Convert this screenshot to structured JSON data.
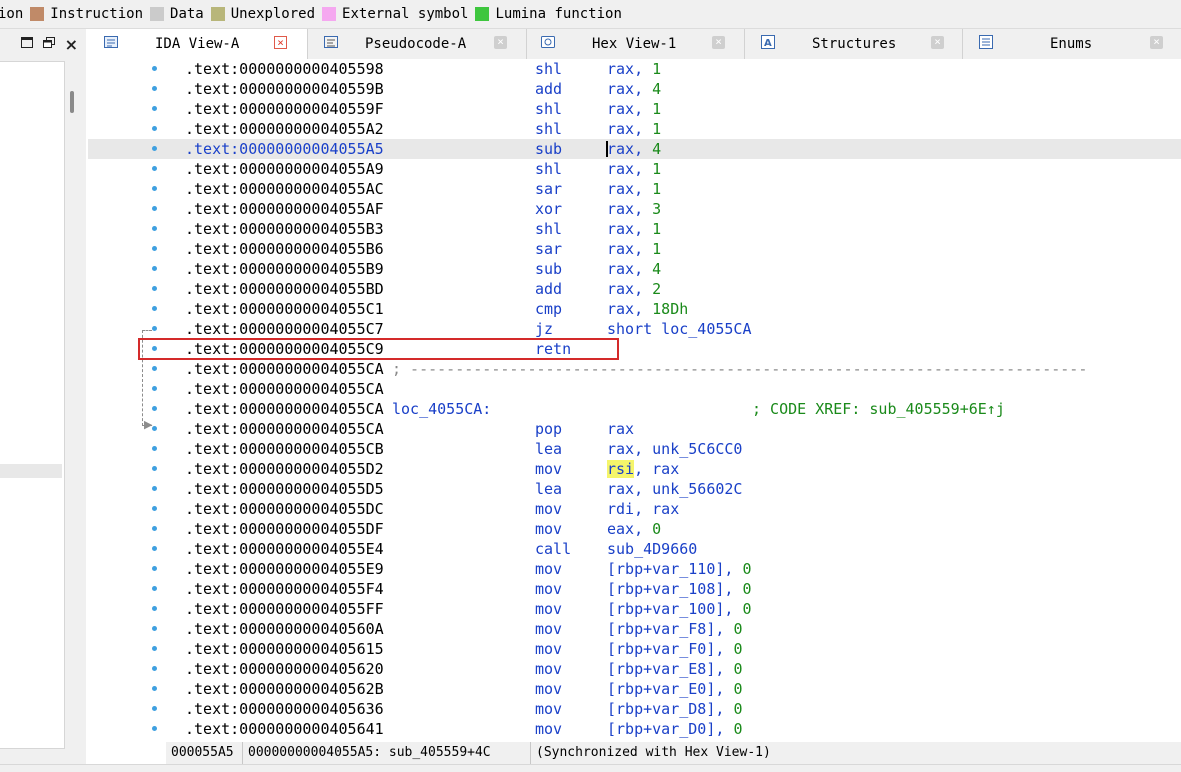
{
  "legend": [
    {
      "label": "ion",
      "color": ""
    },
    {
      "label": "Instruction",
      "color": "#c08a68"
    },
    {
      "label": "Data",
      "color": "#cbcbcb"
    },
    {
      "label": "Unexplored",
      "color": "#b8b67a"
    },
    {
      "label": "External symbol",
      "color": "#f5a8f0"
    },
    {
      "label": "Lumina function",
      "color": "#3ec63e"
    }
  ],
  "left_toolbar": {
    "restore_icon": "maximize-icon",
    "float_icon": "float-icon",
    "close": "×"
  },
  "tabs": [
    {
      "label": "IDA View-A",
      "icon": "ida-view-icon",
      "active": true
    },
    {
      "label": "Pseudocode-A",
      "icon": "pseudocode-icon",
      "active": false
    },
    {
      "label": "Hex View-1",
      "icon": "hex-view-icon",
      "active": false
    },
    {
      "label": "Structures",
      "icon": "structures-icon",
      "active": false
    },
    {
      "label": "Enums",
      "icon": "enums-icon",
      "active": false
    }
  ],
  "tab_close_glyph": "×",
  "listing": {
    "rows": [
      {
        "addr": ".text:0000000000405598",
        "mn": "shl",
        "op": "rax, ",
        "num": "1"
      },
      {
        "addr": ".text:000000000040559B",
        "mn": "add",
        "op": "rax, ",
        "num": "4"
      },
      {
        "addr": ".text:000000000040559F",
        "mn": "shl",
        "op": "rax, ",
        "num": "1"
      },
      {
        "addr": ".text:00000000004055A2",
        "mn": "shl",
        "op": "rax, ",
        "num": "1"
      },
      {
        "addr": ".text:00000000004055A5",
        "mn": "sub",
        "op": "rax, ",
        "num": "4",
        "selected": true
      },
      {
        "addr": ".text:00000000004055A9",
        "mn": "shl",
        "op": "rax, ",
        "num": "1"
      },
      {
        "addr": ".text:00000000004055AC",
        "mn": "sar",
        "op": "rax, ",
        "num": "1"
      },
      {
        "addr": ".text:00000000004055AF",
        "mn": "xor",
        "op": "rax, ",
        "num": "3"
      },
      {
        "addr": ".text:00000000004055B3",
        "mn": "shl",
        "op": "rax, ",
        "num": "1"
      },
      {
        "addr": ".text:00000000004055B6",
        "mn": "sar",
        "op": "rax, ",
        "num": "1"
      },
      {
        "addr": ".text:00000000004055B9",
        "mn": "sub",
        "op": "rax, ",
        "num": "4"
      },
      {
        "addr": ".text:00000000004055BD",
        "mn": "add",
        "op": "rax, ",
        "num": "2"
      },
      {
        "addr": ".text:00000000004055C1",
        "mn": "cmp",
        "op": "rax, ",
        "num": "18Dh"
      },
      {
        "addr": ".text:00000000004055C7",
        "mn": "jz",
        "op": "short loc_4055CA",
        "num": ""
      },
      {
        "addr": ".text:00000000004055C9",
        "mn": "retn",
        "op": "",
        "num": "",
        "boxed": true
      },
      {
        "addr": ".text:00000000004055CA",
        "separator": "; ---------------------------------------------------------------------------"
      },
      {
        "addr": ".text:00000000004055CA"
      },
      {
        "addr": ".text:00000000004055CA",
        "label": "loc_4055CA:",
        "comment": "; CODE XREF: sub_405559+6E↑j"
      },
      {
        "addr": ".text:00000000004055CA",
        "mn": "pop",
        "op": "rax",
        "num": ""
      },
      {
        "addr": ".text:00000000004055CB",
        "mn": "lea",
        "op": "rax, unk_5C6CC0",
        "num": ""
      },
      {
        "addr": ".text:00000000004055D2",
        "mn": "mov",
        "op_hl": "rsi",
        "op": ", rax",
        "num": ""
      },
      {
        "addr": ".text:00000000004055D5",
        "mn": "lea",
        "op": "rax, unk_56602C",
        "num": ""
      },
      {
        "addr": ".text:00000000004055DC",
        "mn": "mov",
        "op": "rdi, rax",
        "num": ""
      },
      {
        "addr": ".text:00000000004055DF",
        "mn": "mov",
        "op": "eax, ",
        "num": "0"
      },
      {
        "addr": ".text:00000000004055E4",
        "mn": "call",
        "op": "sub_4D9660",
        "num": ""
      },
      {
        "addr": ".text:00000000004055E9",
        "mn": "mov",
        "op": "[rbp+var_110], ",
        "num": "0"
      },
      {
        "addr": ".text:00000000004055F4",
        "mn": "mov",
        "op": "[rbp+var_108], ",
        "num": "0"
      },
      {
        "addr": ".text:00000000004055FF",
        "mn": "mov",
        "op": "[rbp+var_100], ",
        "num": "0"
      },
      {
        "addr": ".text:000000000040560A",
        "mn": "mov",
        "op": "[rbp+var_F8], ",
        "num": "0"
      },
      {
        "addr": ".text:0000000000405615",
        "mn": "mov",
        "op": "[rbp+var_F0], ",
        "num": "0"
      },
      {
        "addr": ".text:0000000000405620",
        "mn": "mov",
        "op": "[rbp+var_E8], ",
        "num": "0"
      },
      {
        "addr": ".text:000000000040562B",
        "mn": "mov",
        "op": "[rbp+var_E0], ",
        "num": "0"
      },
      {
        "addr": ".text:0000000000405636",
        "mn": "mov",
        "op": "[rbp+var_D8], ",
        "num": "0"
      },
      {
        "addr": ".text:0000000000405641",
        "mn": "mov",
        "op": "[rbp+var_D0], ",
        "num": "0"
      }
    ]
  },
  "status": {
    "offset": "000055A5",
    "location": "00000000004055A5: sub_405559+4C",
    "sync": "(Synchronized with Hex View-1)"
  },
  "colors": {
    "accent": "#1a40c8",
    "number": "#1a8a1a",
    "highlight": "#f5f56a",
    "redbox": "#d42a2a",
    "dot": "#3fa0e0"
  }
}
